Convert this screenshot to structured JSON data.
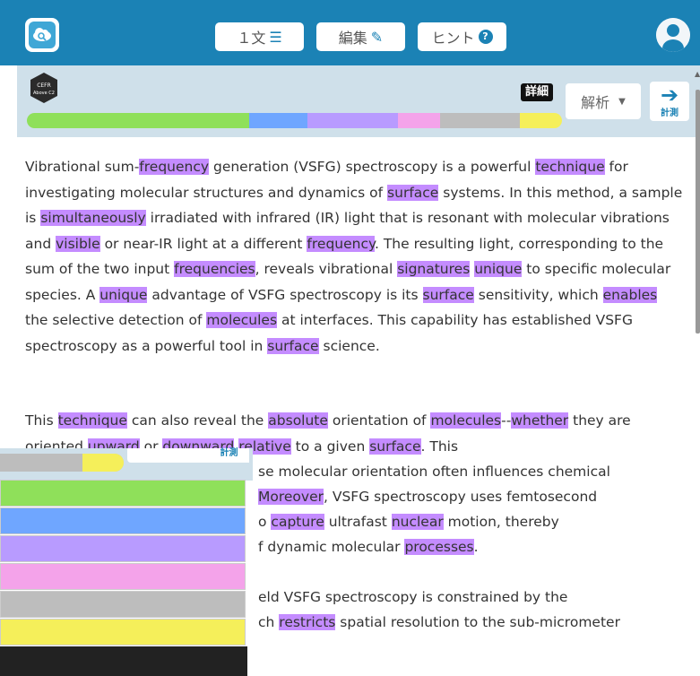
{
  "header": {
    "sentence_button": "１文",
    "edit_button": "編集",
    "hint_button": "ヒント"
  },
  "level": {
    "badge_line1": "CEFR",
    "badge_line2": "Above C2",
    "detail_label": "詳細",
    "analysis_label": "解析",
    "measure_label": "計測",
    "bar_colors": [
      "#8fe05a",
      "#6fa6ff",
      "#b89bff",
      "#f4a3ea",
      "#bdbdbd",
      "#f5ef5a"
    ],
    "bar_shares": [
      0.42,
      0.11,
      0.17,
      0.08,
      0.15,
      0.08
    ]
  },
  "paragraphs": [
    [
      {
        "t": "Vibrational sum-"
      },
      {
        "t": "frequency",
        "h": true
      },
      {
        "t": " generation (VSFG) spectroscopy is a powerful "
      },
      {
        "t": "technique",
        "h": true
      },
      {
        "t": " for investigating molecular structures and dynamics of "
      },
      {
        "t": "surface",
        "h": true
      },
      {
        "t": " systems. In this method, a sample is "
      },
      {
        "t": "simultaneously",
        "h": true
      },
      {
        "t": " irradiated with infrared (IR) light that is resonant with molecular vibrations and "
      },
      {
        "t": "visible",
        "h": true
      },
      {
        "t": " or near-IR light at a different "
      },
      {
        "t": "frequency",
        "h": true
      },
      {
        "t": ". The resulting light, corresponding to the sum of the two input "
      },
      {
        "t": "frequencies",
        "h": true
      },
      {
        "t": ", reveals vibrational "
      },
      {
        "t": "signatures",
        "h": true
      },
      {
        "t": " "
      },
      {
        "t": "unique",
        "h": true
      },
      {
        "t": " to specific molecular species. A "
      },
      {
        "t": "unique",
        "h": true
      },
      {
        "t": " advantage of VSFG spectroscopy is its "
      },
      {
        "t": "surface",
        "h": true
      },
      {
        "t": " sensitivity, which "
      },
      {
        "t": "enables",
        "h": true
      },
      {
        "t": " the selective detection of "
      },
      {
        "t": "molecules",
        "h": true
      },
      {
        "t": " at interfaces. This capability has established VSFG spectroscopy as a powerful tool in "
      },
      {
        "t": "surface",
        "h": true
      },
      {
        "t": " science."
      }
    ],
    [
      {
        "t": "This "
      },
      {
        "t": "technique",
        "h": true
      },
      {
        "t": " can also reveal the "
      },
      {
        "t": "absolute",
        "h": true
      },
      {
        "t": " orientation of "
      },
      {
        "t": "molecules",
        "h": true
      },
      {
        "t": "--"
      },
      {
        "t": "whether",
        "h": true
      },
      {
        "t": " they are oriented "
      },
      {
        "t": "upward",
        "h": true
      },
      {
        "t": " or "
      },
      {
        "t": "downward",
        "h": true
      },
      {
        "t": " "
      },
      {
        "t": "relative",
        "h": true
      },
      {
        "t": " to a given "
      },
      {
        "t": "surface",
        "h": true
      },
      {
        "t": ". This"
      }
    ]
  ],
  "fragments": [
    {
      "t": "se molecular orientation often influences chemical"
    },
    {
      "pre": "",
      "h": "Moreover",
      "post": ", VSFG spectroscopy uses femtosecond"
    },
    {
      "pre": "o ",
      "h": "capture",
      "mid": " ultrafast ",
      "h2": "nuclear",
      "post": " motion, thereby"
    },
    {
      "pre": "f dynamic molecular ",
      "h": "processes",
      "post": "."
    },
    {
      "t": "eld VSFG spectroscopy is constrained by the"
    },
    {
      "pre": "ch ",
      "h": "restricts",
      "post": " spatial resolution to the sub-micrometer"
    }
  ],
  "overlay": {
    "measure_label": "計測",
    "row_colors": [
      "#8fe05a",
      "#6fa6ff",
      "#b89bff",
      "#f4a3ea",
      "#bdbdbd",
      "#f5ef5a",
      "#222222"
    ]
  }
}
